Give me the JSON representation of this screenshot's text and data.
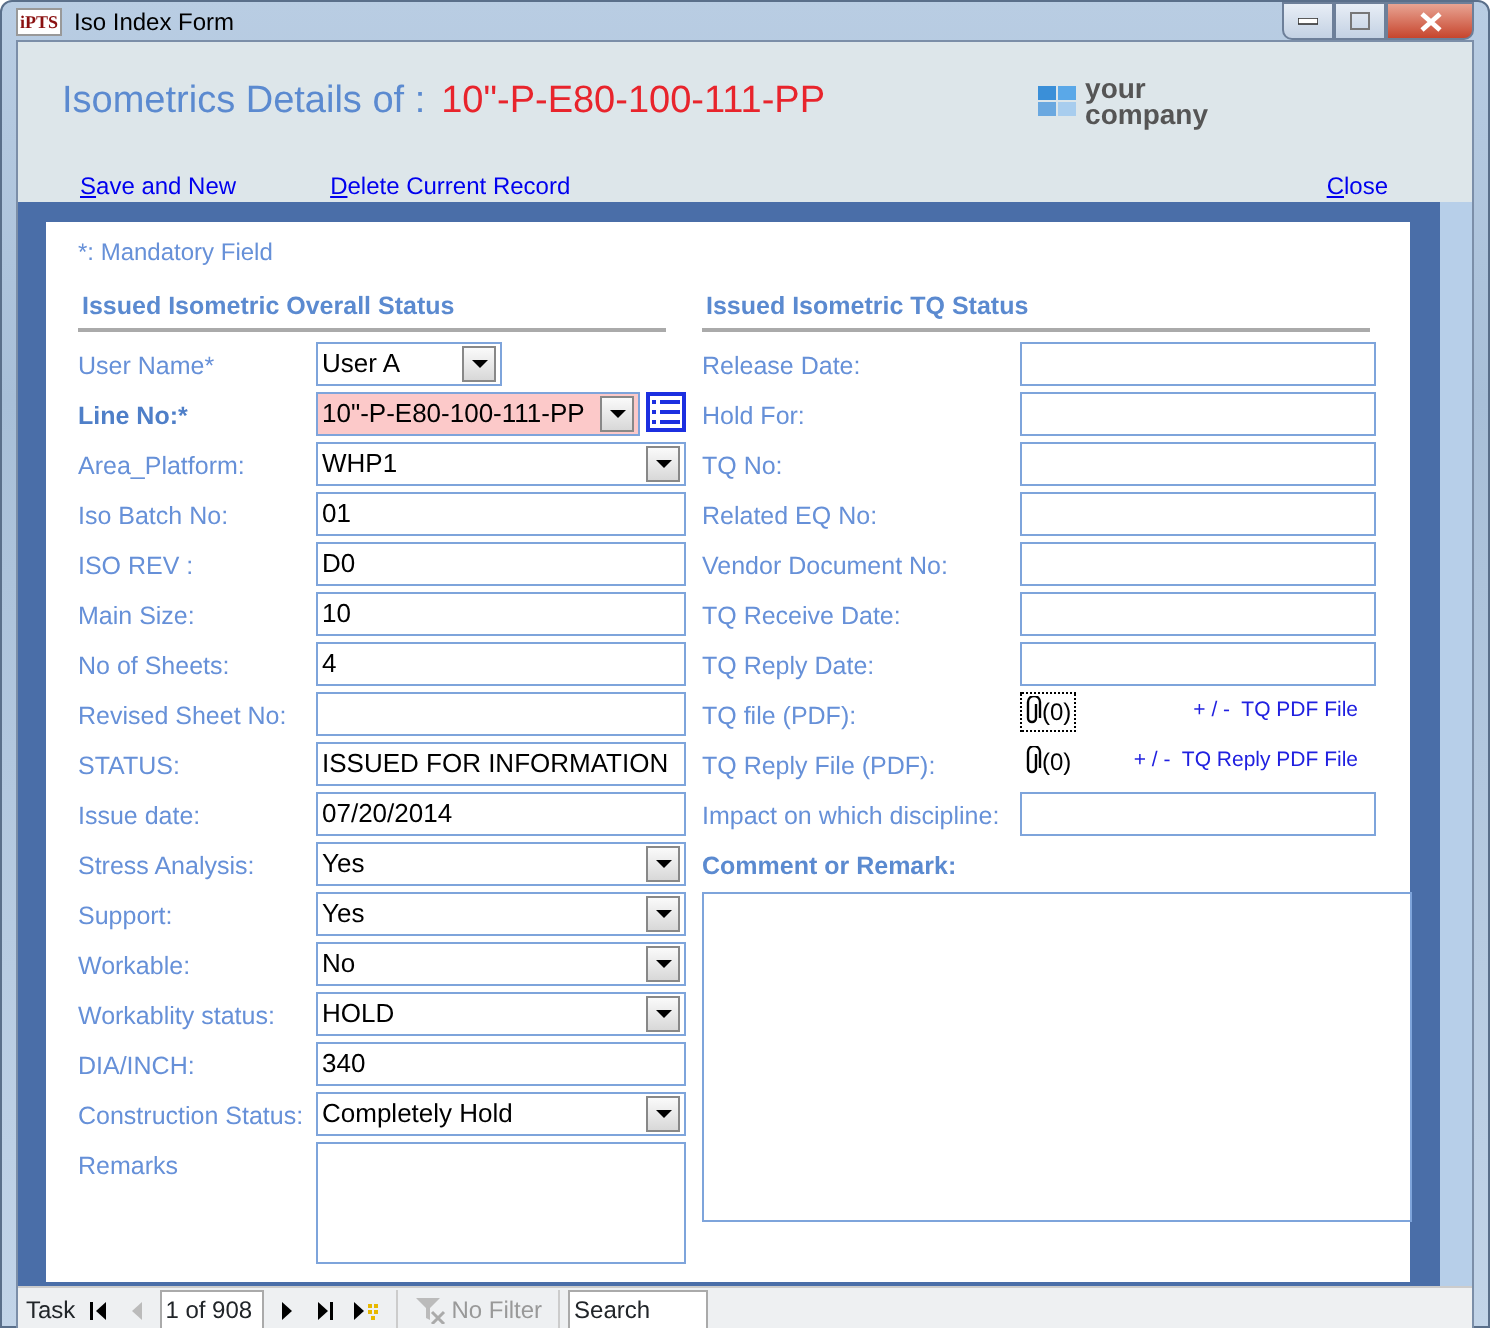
{
  "window": {
    "title": "Iso Index Form",
    "app_icon": "iPTS"
  },
  "header": {
    "title": "Isometrics Details of :",
    "record_id": "10\"-P-E80-100-111-PP",
    "logo_lines": [
      "your",
      "company"
    ]
  },
  "actions": [
    {
      "access_key": "S",
      "rest": "ave and New"
    },
    {
      "access_key": "D",
      "rest": "elete Current Record"
    }
  ],
  "close_action": {
    "access_key": "C",
    "rest": "lose"
  },
  "note": "*: Mandatory Field",
  "left_section": {
    "heading": "Issued Isometric Overall Status",
    "fields": [
      {
        "label": "User Name*",
        "kind": "short-combo",
        "value": "User A",
        "emphasized": false,
        "highlighted": false
      },
      {
        "label": "Line No:*",
        "kind": "lookup-combo",
        "value": "10\"-P-E80-100-111-PP",
        "emphasized": true,
        "highlighted": true
      },
      {
        "label": "Area_Platform:",
        "kind": "combo",
        "value": "WHP1",
        "emphasized": false,
        "highlighted": false
      },
      {
        "label": "Iso Batch No:",
        "kind": "text",
        "value": "01",
        "emphasized": false,
        "highlighted": false
      },
      {
        "label": "ISO REV :",
        "kind": "text",
        "value": "D0",
        "emphasized": false,
        "highlighted": false
      },
      {
        "label": "Main Size:",
        "kind": "text",
        "value": "10",
        "emphasized": false,
        "highlighted": false
      },
      {
        "label": "No of Sheets:",
        "kind": "text",
        "value": "4",
        "emphasized": false,
        "highlighted": false
      },
      {
        "label": "Revised Sheet No:",
        "kind": "text",
        "emphasized": false,
        "highlighted": false
      },
      {
        "label": "STATUS:",
        "kind": "text",
        "value": "ISSUED FOR INFORMATION",
        "emphasized": false,
        "highlighted": false
      },
      {
        "label": "Issue date:",
        "kind": "text",
        "value": "07/20/2014",
        "emphasized": false,
        "highlighted": false
      },
      {
        "label": "Stress Analysis:",
        "kind": "combo",
        "value": "Yes",
        "emphasized": false,
        "highlighted": false
      },
      {
        "label": "Support:",
        "kind": "combo",
        "value": "Yes",
        "emphasized": false,
        "highlighted": false
      },
      {
        "label": "Workable:",
        "kind": "combo",
        "value": "No",
        "emphasized": false,
        "highlighted": false
      },
      {
        "label": "Workablity status:",
        "kind": "combo",
        "value": "HOLD",
        "emphasized": false,
        "highlighted": false
      },
      {
        "label": "DIA/INCH:",
        "kind": "text",
        "value": "340",
        "emphasized": false,
        "highlighted": false
      },
      {
        "label": "Construction Status:",
        "kind": "combo",
        "value": "Completely Hold",
        "emphasized": false,
        "highlighted": false
      },
      {
        "label": "Remarks",
        "kind": "memo",
        "emphasized": false,
        "highlighted": false
      }
    ]
  },
  "right_section": {
    "heading": "Issued Isometric TQ Status",
    "fields": [
      {
        "label": "Release Date:",
        "kind": "text"
      },
      {
        "label": "Hold For:",
        "kind": "text"
      },
      {
        "label": "TQ No:",
        "kind": "text"
      },
      {
        "label": "Related EQ No:",
        "kind": "text"
      },
      {
        "label": "Vendor Document No:",
        "kind": "text"
      },
      {
        "label": "TQ Receive Date:",
        "kind": "text"
      },
      {
        "label": "TQ Reply Date:",
        "kind": "text"
      },
      {
        "label": "TQ file (PDF):",
        "kind": "attachment",
        "count": "(0)",
        "focused": true,
        "link": "+ / -  TQ PDF File"
      },
      {
        "label": "TQ Reply File (PDF):",
        "kind": "attachment",
        "count": "(0)",
        "focused": false,
        "link": "+ / -  TQ Reply PDF File"
      },
      {
        "label": "Impact on which discipline:",
        "kind": "text"
      }
    ],
    "comment_heading": "Comment or Remark:"
  },
  "navigation": {
    "label": "Task",
    "record": "1 of 908",
    "filter": "No Filter",
    "filter_disabled": true,
    "search": "Search",
    "prev_disabled": true
  }
}
